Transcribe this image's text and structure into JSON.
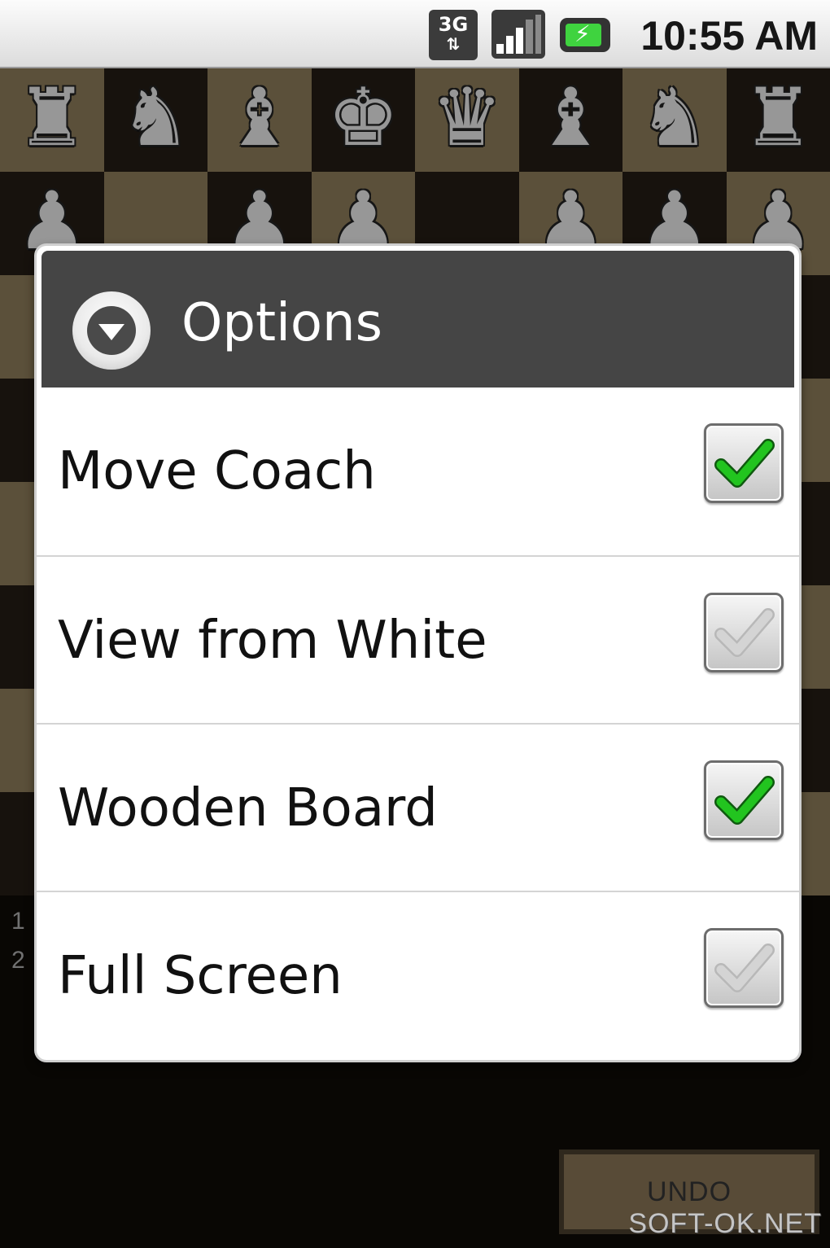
{
  "status_bar": {
    "network_type": "3G",
    "network_arrows": "⇅",
    "time": "10:55 AM",
    "icons": [
      "3g-icon",
      "signal-icon",
      "battery-charging-icon"
    ]
  },
  "board": {
    "rows": [
      [
        "♜",
        "♞",
        "♝",
        "♚",
        "♛",
        "♝",
        "♞",
        "♜"
      ],
      [
        "♟",
        "",
        "♟",
        "♟",
        "",
        "♟",
        "♟",
        "♟"
      ],
      [
        "",
        "",
        "",
        "",
        "",
        "",
        "",
        ""
      ],
      [
        "",
        "",
        "",
        "",
        "",
        "",
        "",
        ""
      ],
      [
        "",
        "",
        "",
        "",
        "",
        "",
        "",
        ""
      ],
      [
        "",
        "",
        "",
        "",
        "",
        "",
        "",
        ""
      ],
      [
        "",
        "",
        "",
        "",
        "",
        "",
        "",
        ""
      ],
      [
        "",
        "",
        "",
        "",
        "",
        "",
        "",
        ""
      ]
    ],
    "light_color": "#6f6247",
    "dark_color": "#1d1710"
  },
  "move_list": [
    "1",
    "2"
  ],
  "undo_label": "UNDO",
  "watermark": "SOFT-OK.NET",
  "dialog": {
    "title": "Options",
    "icon": "chevron-down-circle-icon",
    "options": [
      {
        "label": "Move Coach",
        "checked": true
      },
      {
        "label": "View from White",
        "checked": false
      },
      {
        "label": "Wooden Board",
        "checked": true
      },
      {
        "label": "Full Screen",
        "checked": false
      }
    ],
    "check_color_on": "#22c41f",
    "check_color_off": "#d4d4d4"
  }
}
